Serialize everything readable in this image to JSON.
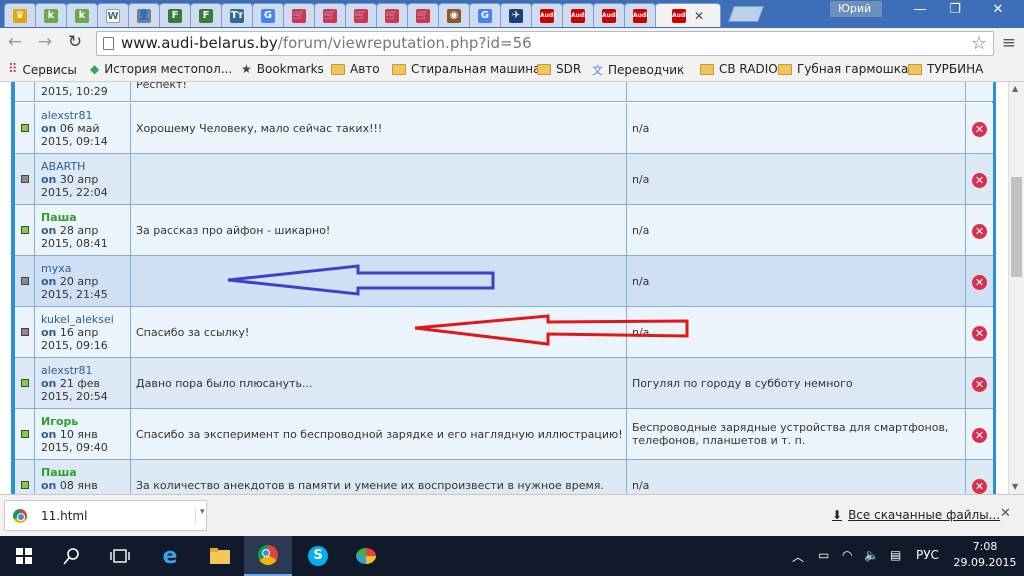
{
  "window": {
    "user": "Юрий",
    "controls": {
      "minimize": "—",
      "maximize": "❐",
      "close": "✕"
    }
  },
  "tabs": [
    {
      "fav": "♛",
      "color": "#e5a50a"
    },
    {
      "fav": "k",
      "color": "#6aa84f"
    },
    {
      "fav": "k",
      "color": "#6aa84f"
    },
    {
      "fav": "W",
      "color": "#ffffff"
    },
    {
      "fav": "👤",
      "color": "#7f7f7f"
    },
    {
      "fav": "F",
      "color": "#3b7a3b"
    },
    {
      "fav": "F",
      "color": "#3b7a3b"
    },
    {
      "fav": "Tт",
      "color": "#2d6a9a"
    },
    {
      "fav": "G",
      "color": "#4285f4"
    },
    {
      "fav": "🛒",
      "color": "#d9304e"
    },
    {
      "fav": "🛒",
      "color": "#d9304e"
    },
    {
      "fav": "🛒",
      "color": "#d9304e"
    },
    {
      "fav": "🛒",
      "color": "#d9304e"
    },
    {
      "fav": "🛒",
      "color": "#d9304e"
    },
    {
      "fav": "◉",
      "color": "#8a5a2a"
    },
    {
      "fav": "G",
      "color": "#4285f4"
    },
    {
      "fav": "✈",
      "color": "#1a3f7a"
    },
    {
      "fav": "Audi",
      "color": "#cc0000"
    },
    {
      "fav": "Audi",
      "color": "#cc0000"
    },
    {
      "fav": "Audi",
      "color": "#cc0000"
    },
    {
      "fav": "Audi",
      "color": "#cc0000"
    }
  ],
  "toolbar": {
    "back": "←",
    "forward": "→",
    "reload": "↻",
    "url_host": "www.audi-belarus.by",
    "url_path": "/forum/viewreputation.php?id=56",
    "star": "☆",
    "menu": "≡"
  },
  "bookmarks": [
    {
      "label": "Сервисы",
      "icon": "apps-icon"
    },
    {
      "label": "История местопол...",
      "icon": "maps-icon"
    },
    {
      "label": "Bookmarks",
      "icon": "star-icon"
    },
    {
      "label": "Авто",
      "icon": "folder-icon"
    },
    {
      "label": "Стиральная машина",
      "icon": "folder-icon"
    },
    {
      "label": "SDR",
      "icon": "folder-icon"
    },
    {
      "label": "Переводчик",
      "icon": "translate-icon"
    },
    {
      "label": "CB RADIO",
      "icon": "folder-icon"
    },
    {
      "label": "Губная гармошка",
      "icon": "folder-icon"
    },
    {
      "label": "ТУРБИНА",
      "icon": "folder-icon"
    }
  ],
  "partial_row": {
    "date": "2015, 10:29",
    "comment": "Респект!"
  },
  "rows": [
    {
      "user": "alexstr81",
      "green": false,
      "online": true,
      "on": "on",
      "date1": " 06 май",
      "date2": "2015, 09:14",
      "comment": "Хорошему Человеку, мало сейчас таких!!!",
      "post": "n/a"
    },
    {
      "user": "ABARTH",
      "green": false,
      "online": false,
      "on": "on",
      "date1": " 30 апр",
      "date2": "2015, 22:04",
      "comment": "",
      "post": "n/a"
    },
    {
      "user": "Паша",
      "green": true,
      "online": true,
      "on": "on",
      "date1": " 28 апр",
      "date2": "2015, 08:41",
      "comment": "За рассказ про айфон - шикарно!",
      "post": "n/a"
    },
    {
      "user": "myxa",
      "green": false,
      "online": false,
      "on": "on",
      "date1": " 20 апр",
      "date2": "2015, 21:45",
      "comment": "",
      "post": "n/a"
    },
    {
      "user": "kukel_aleksei",
      "green": false,
      "online": false,
      "on": "on",
      "date1": " 16 апр",
      "date2": "2015, 09:16",
      "comment": "Спасибо за ссылку!",
      "post": "n/a"
    },
    {
      "user": "alexstr81",
      "green": false,
      "online": true,
      "on": "on",
      "date1": " 21 фев",
      "date2": "2015, 20:54",
      "comment": "Давно пора было плюсануть...",
      "post": "Погулял по городу в субботу немного"
    },
    {
      "user": "Игорь",
      "green": true,
      "online": true,
      "on": "on",
      "date1": " 10 янв",
      "date2": "2015, 09:40",
      "comment": "Спасибо за эксперимент по беспроводной зарядке и его наглядную иллюстрацию!",
      "post": "Беспроводные зарядные устройства для смартфонов, телефонов, планшетов и т. п."
    },
    {
      "user": "Паша",
      "green": true,
      "online": true,
      "on": "on",
      "date1": " 08 янв",
      "date2": "",
      "comment": "За количество анекдотов в памяти и умение их воспроизвести в нужное время.",
      "post": "n/a"
    }
  ],
  "download": {
    "filename": "11.html",
    "all_downloads": "Все скачанные файлы...",
    "close": "✕"
  },
  "taskbar": {
    "language": "РУС",
    "time": "7:08",
    "date": "29.09.2015"
  },
  "colors": {
    "arrow_blue": "#3a43c8",
    "arrow_red": "#e01818"
  }
}
